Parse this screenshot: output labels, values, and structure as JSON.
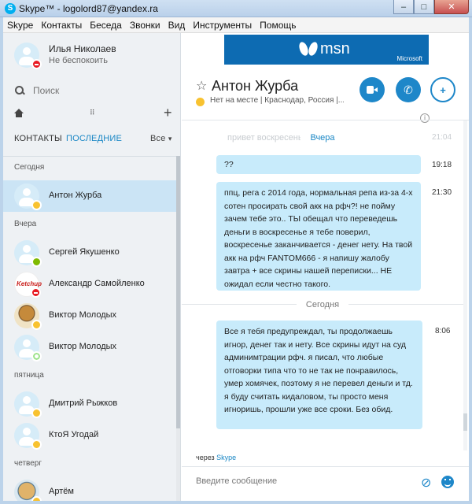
{
  "window": {
    "title": "Skype™ - logolord87@yandex.ra",
    "app_icon": "S",
    "min": "–",
    "max": "□",
    "close": "✕"
  },
  "menu": [
    "Skype",
    "Контакты",
    "Беседа",
    "Звонки",
    "Вид",
    "Инструменты",
    "Помощь"
  ],
  "me": {
    "name": "Илья Николаев",
    "status": "Не беспокоить"
  },
  "search": {
    "placeholder": "Поиск"
  },
  "tabs": {
    "contacts": "КОНТАКТЫ",
    "recent": "ПОСЛЕДНИЕ",
    "filter": "Все",
    "filter_chevron": "▾"
  },
  "groups": [
    "Сегодня",
    "Вчера",
    "пятница",
    "четверг"
  ],
  "contacts": [
    "Антон Журба",
    "Сергей Якушенко",
    "Александр Самойленко",
    "Виктор Молодых",
    "Виктор Молодых",
    "Дмитрий Рыжков",
    "КтоЯ Угодай",
    "Артём"
  ],
  "ad": {
    "brand": "msn",
    "sponsor": "Microsoft"
  },
  "conversation": {
    "name": "Антон Журба",
    "subtitle": "Нет на месте | Краснодар, Россия |...",
    "star": "☆"
  },
  "chat": {
    "ghost_text": "привет воскресенье",
    "ghost_time": "21:04",
    "yesterday": "Вчера",
    "today": "Сегодня",
    "messages": [
      {
        "text": "??",
        "time": "19:18"
      },
      {
        "text": "ппц, рега с 2014 года, нормальная репа из-за 4-х сотен просирать свой акк на рфч?! не пойму зачем тебе это.. ТЫ обещал что переведешь деньги в воскресенье я тебе поверил, воскресенье заканчивается - денег нету. На твой акк на рфч FANTOM666 - я напишу жалобу завтра + все скрины нашей переписки... НЕ ожидал если честно такого.",
        "time": "21:30"
      },
      {
        "text": "Все я тебя предупреждал, ты продолжаешь игнор, денег так и нету. Все скрины идут на суд админимтрации рфч. я писал, что любые отговорки типа что то не так не понравилось, умер хомячек, поэтому я не перевел деньги и тд. я буду считать кидаловом, ты просто меня игноришь, прошли уже все сроки. Без обид.",
        "time": "8:06"
      }
    ]
  },
  "via": {
    "prefix": "через",
    "link": "Skype"
  },
  "composer": {
    "placeholder": "Введите сообщение"
  },
  "colors": {
    "accent": "#1e87c9",
    "bubble": "#c8ebfb",
    "active_row": "#cbe4f5",
    "away": "#f8c230",
    "dnd": "#e81b23",
    "online": "#7fba00"
  }
}
